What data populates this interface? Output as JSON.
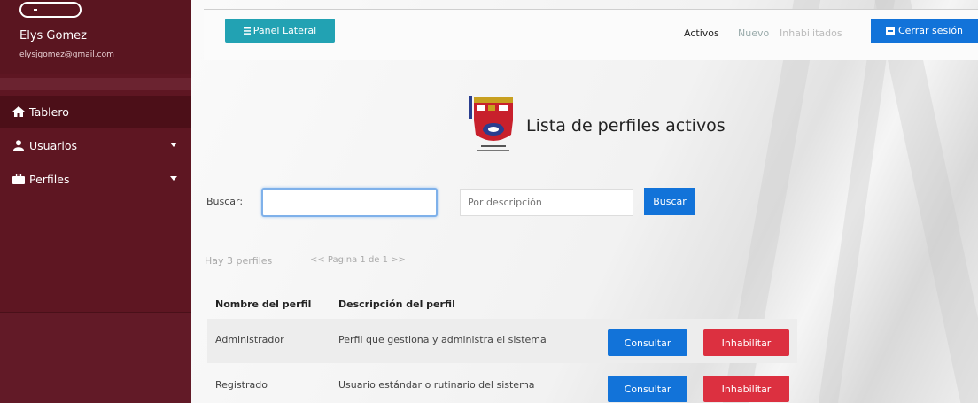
{
  "user": {
    "name": "Elys Gomez",
    "email": "elysjgomez@gmail.com"
  },
  "sidebar": {
    "items": [
      {
        "label": "Tablero",
        "icon": "home-icon"
      },
      {
        "label": "Usuarios",
        "icon": "user-icon"
      },
      {
        "label": "Perfiles",
        "icon": "briefcase-icon"
      }
    ]
  },
  "topbar": {
    "panel_label": "Panel Lateral",
    "links": {
      "activos": "Activos",
      "nuevo": "Nuevo",
      "inhabilitados": "Inhabilitados"
    },
    "logout_label": "Cerrar sesión"
  },
  "page": {
    "title": "Lista de perfiles activos"
  },
  "search": {
    "label": "Buscar:",
    "value": "",
    "desc_placeholder": "Por descripción",
    "button_label": "Buscar"
  },
  "summary": {
    "count_text": "Hay 3 perfiles",
    "pager_text": "<< Pagina 1 de 1 >>"
  },
  "table": {
    "headers": [
      "Nombre del perfil",
      "Descripción del perfil"
    ],
    "rows": [
      {
        "name": "Administrador",
        "description": "Perfil que gestiona y administra el sistema",
        "consult_label": "Consultar",
        "disable_label": "Inhabilitar"
      },
      {
        "name": "Registrado",
        "description": "Usuario estándar o rutinario del sistema",
        "consult_label": "Consultar",
        "disable_label": "Inhabilitar"
      }
    ]
  },
  "colors": {
    "sidebar": "#5e1622",
    "primary": "#1273d9",
    "danger": "#dc3040",
    "info": "#22a2b3"
  }
}
